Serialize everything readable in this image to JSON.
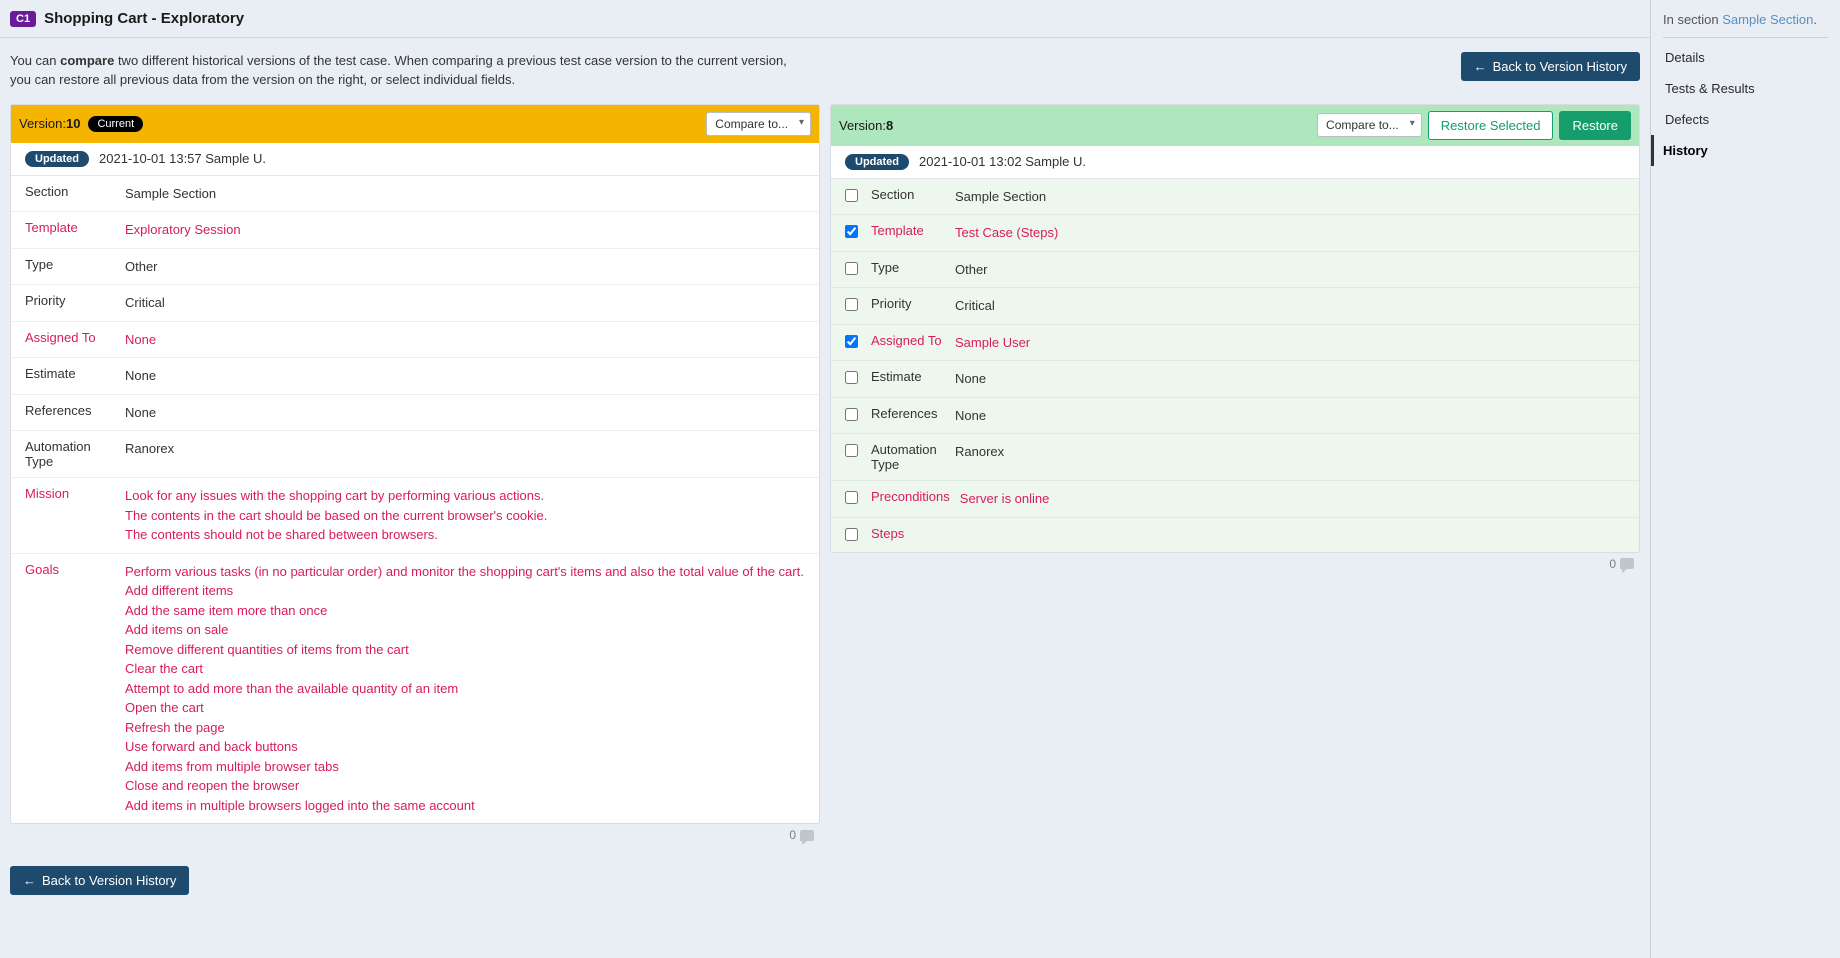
{
  "header": {
    "badge": "C1",
    "title": "Shopping Cart - Exploratory"
  },
  "intro": {
    "prefix": "You can ",
    "bold": "compare",
    "rest": " two different historical versions of the test case. When comparing a previous test case version to the current version, you can restore all previous data from the version on the right, or select individual fields."
  },
  "back_button": "Back to Version History",
  "dropdown_label": "Compare to...",
  "restore_selected": "Restore Selected",
  "restore": "Restore",
  "left": {
    "version_label": "Version:",
    "version": "10",
    "current": "Current",
    "updated_badge": "Updated",
    "updated_text": "2021-10-01 13:57 Sample U.",
    "fields": {
      "section": {
        "label": "Section",
        "value": "Sample Section",
        "diff": false
      },
      "template": {
        "label": "Template",
        "value": "Exploratory Session",
        "diff": true
      },
      "type": {
        "label": "Type",
        "value": "Other",
        "diff": false
      },
      "priority": {
        "label": "Priority",
        "value": "Critical",
        "diff": false
      },
      "assigned": {
        "label": "Assigned To",
        "value": "None",
        "diff": true
      },
      "estimate": {
        "label": "Estimate",
        "value": "None",
        "diff": false
      },
      "references": {
        "label": "References",
        "value": "None",
        "diff": false
      },
      "automation": {
        "label": "Automation Type",
        "value": "Ranorex",
        "diff": false
      },
      "mission": {
        "label": "Mission",
        "value": "Look for any issues with the shopping cart by performing various actions.\nThe contents in the cart should be based on the current browser's cookie.\nThe contents should not be shared between browsers.",
        "diff": true
      },
      "goals": {
        "label": "Goals",
        "value": "Perform various tasks (in no particular order) and monitor the shopping cart's items and also the total value of the cart.\nAdd different items\nAdd the same item more than once\nAdd items on sale\nRemove different quantities of items from the cart\nClear the cart\nAttempt to add more than the available quantity of an item\nOpen the cart\nRefresh the page\nUse forward and back buttons\nAdd items from multiple browser tabs\nClose and reopen the browser\nAdd items in multiple browsers logged into the same account",
        "diff": true
      }
    },
    "comments": "0"
  },
  "right": {
    "version_label": "Version:",
    "version": "8",
    "updated_badge": "Updated",
    "updated_text": "2021-10-01 13:02 Sample U.",
    "fields": {
      "section": {
        "label": "Section",
        "value": "Sample Section",
        "diff": false,
        "checked": false
      },
      "template": {
        "label": "Template",
        "value": "Test Case (Steps)",
        "diff": true,
        "checked": true
      },
      "type": {
        "label": "Type",
        "value": "Other",
        "diff": false,
        "checked": false
      },
      "priority": {
        "label": "Priority",
        "value": "Critical",
        "diff": false,
        "checked": false
      },
      "assigned": {
        "label": "Assigned To",
        "value": "Sample User",
        "diff": true,
        "checked": true
      },
      "estimate": {
        "label": "Estimate",
        "value": "None",
        "diff": false,
        "checked": false
      },
      "references": {
        "label": "References",
        "value": "None",
        "diff": false,
        "checked": false
      },
      "automation": {
        "label": "Automation Type",
        "value": "Ranorex",
        "diff": false,
        "checked": false
      },
      "preconditions": {
        "label": "Preconditions",
        "value": "Server is online",
        "diff": true,
        "checked": false
      },
      "steps": {
        "label": "Steps",
        "value": " ",
        "diff": true,
        "checked": false
      }
    },
    "comments": "0"
  },
  "sidebar": {
    "in_section_prefix": "In section ",
    "section_link": "Sample Section",
    "nav": {
      "details": "Details",
      "tests": "Tests & Results",
      "defects": "Defects",
      "history": "History"
    }
  }
}
